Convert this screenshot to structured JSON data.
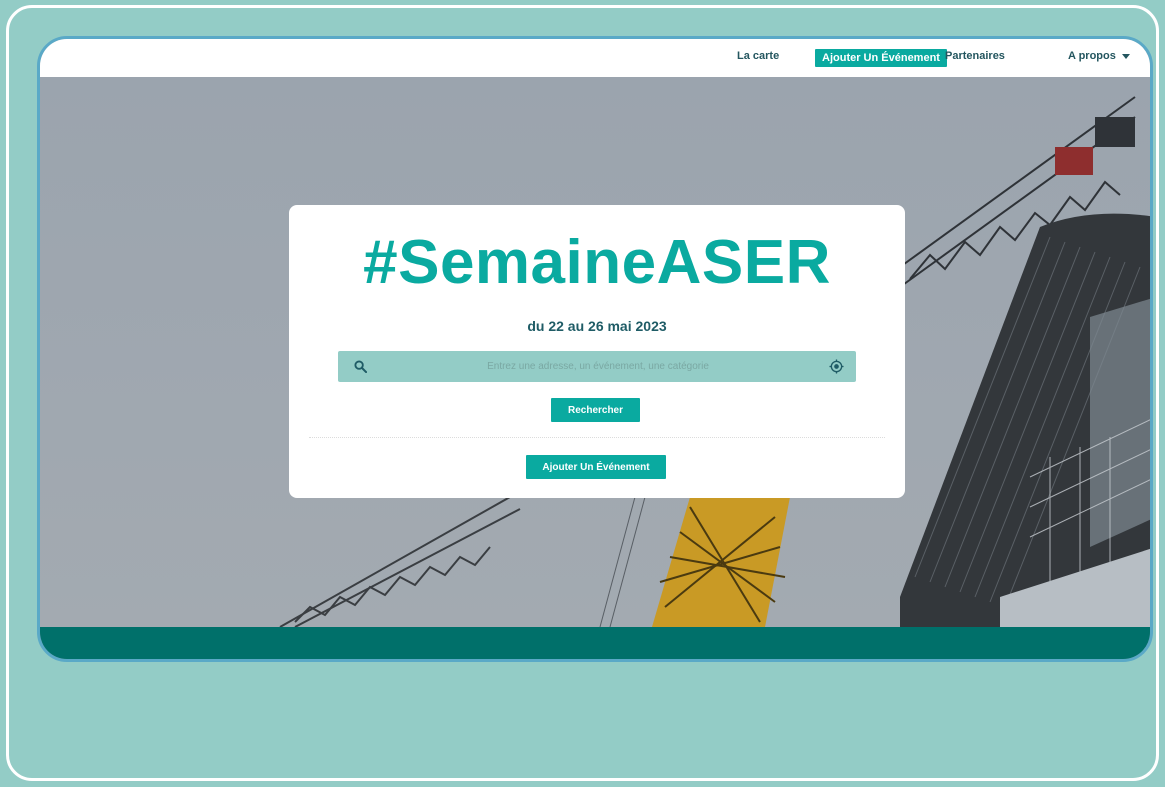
{
  "nav": {
    "items": [
      {
        "label": "La carte"
      },
      {
        "label": "Ajouter Un Événement",
        "active": true
      },
      {
        "label": "Partenaires"
      },
      {
        "label": "A propos",
        "has_dropdown": true
      }
    ]
  },
  "hero": {
    "title": "#SemaineASER",
    "subtitle": "du 22 au 26 mai 2023",
    "search": {
      "placeholder": "Entrez une adresse, un événement, une catégorie",
      "value": ""
    },
    "search_button": "Rechercher",
    "add_button": "Ajouter Un Événement"
  },
  "icons": {
    "search": "search-icon",
    "locate": "locate-icon",
    "dropdown": "chevron-down-icon"
  },
  "colors": {
    "accent": "#0aaaa0",
    "search_bg": "#93ccc6",
    "footer_band": "#00706a",
    "page_bg": "#93ccc6"
  }
}
